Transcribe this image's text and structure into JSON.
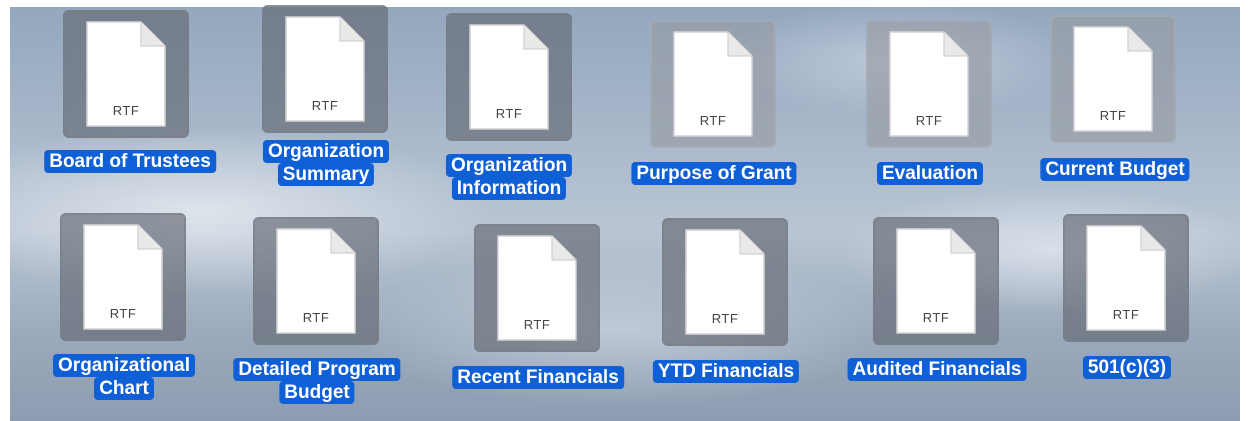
{
  "desktop": {
    "file_type": "RTF",
    "items": [
      {
        "lines": [
          "Board of Trustees"
        ]
      },
      {
        "lines": [
          "Organization",
          "Summary"
        ]
      },
      {
        "lines": [
          "Organization",
          "Information"
        ]
      },
      {
        "lines": [
          "Purpose of Grant"
        ]
      },
      {
        "lines": [
          "Evaluation"
        ]
      },
      {
        "lines": [
          "Current Budget"
        ]
      },
      {
        "lines": [
          "Organizational",
          "Chart"
        ]
      },
      {
        "lines": [
          "Detailed Program",
          "Budget"
        ]
      },
      {
        "lines": [
          "Recent Financials"
        ]
      },
      {
        "lines": [
          "YTD Financials"
        ]
      },
      {
        "lines": [
          "Audited Financials"
        ]
      },
      {
        "lines": [
          "501(c)(3)"
        ]
      }
    ],
    "icon": "rtf-document-icon",
    "selection_color": "#0f5fd6"
  }
}
